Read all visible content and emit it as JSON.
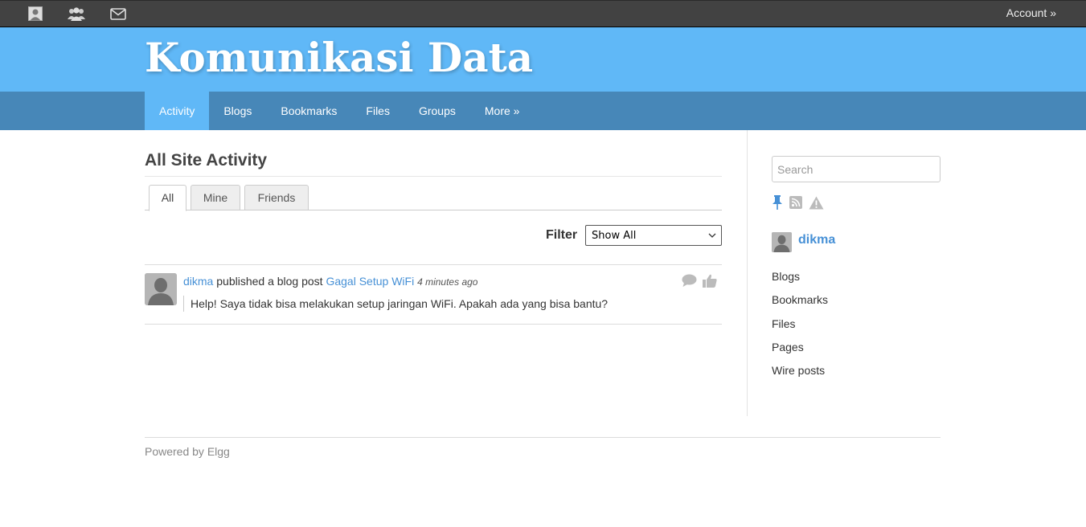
{
  "topbar": {
    "icons": [
      "profile-icon",
      "friends-icon",
      "messages-icon"
    ],
    "account_label": "Account »"
  },
  "header": {
    "site_title": "Komunikasi Data"
  },
  "nav": {
    "items": [
      {
        "label": "Activity",
        "active": true
      },
      {
        "label": "Blogs"
      },
      {
        "label": "Bookmarks"
      },
      {
        "label": "Files"
      },
      {
        "label": "Groups"
      },
      {
        "label": "More »"
      }
    ]
  },
  "main": {
    "title": "All Site Activity",
    "tabs": [
      {
        "label": "All",
        "active": true
      },
      {
        "label": "Mine"
      },
      {
        "label": "Friends"
      }
    ],
    "filter": {
      "label": "Filter",
      "selected": "Show All"
    },
    "activity": [
      {
        "user": "dikma",
        "action": "published a blog post",
        "object": "Gagal Setup WiFi",
        "time": "4 minutes ago",
        "excerpt": "Help! Saya tidak bisa melakukan setup jaringan WiFi. Apakah ada yang bisa bantu?"
      }
    ]
  },
  "sidebar": {
    "search_placeholder": "Search",
    "icons": [
      "pin-icon",
      "rss-icon",
      "warning-icon"
    ],
    "owner": "dikma",
    "menu": [
      "Blogs",
      "Bookmarks",
      "Files",
      "Pages",
      "Wire posts"
    ]
  },
  "footer": {
    "text": "Powered by Elgg"
  },
  "colors": {
    "topbar": "#424242",
    "header": "#60b8f7",
    "nav": "#4787b8",
    "link": "#4690d6"
  }
}
